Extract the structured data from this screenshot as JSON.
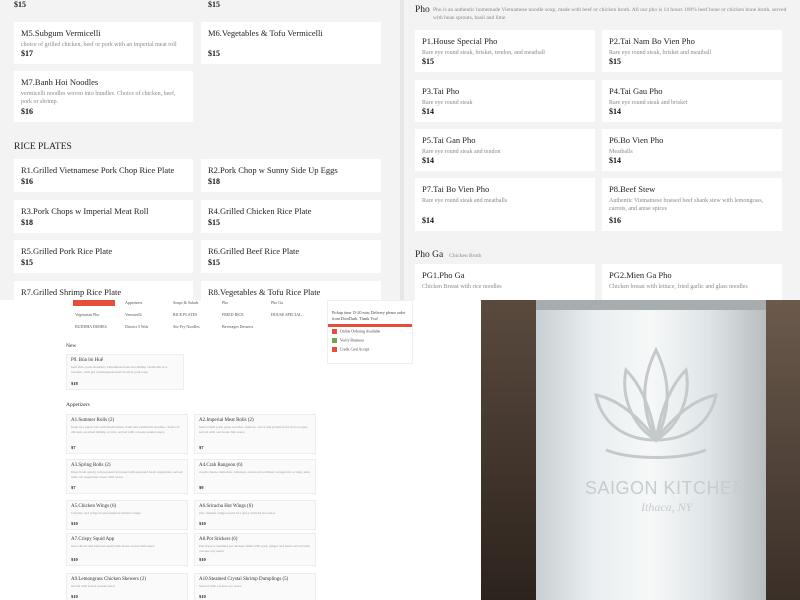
{
  "top_left": {
    "prices_top": [
      "$15",
      "$15"
    ],
    "items_top": [
      {
        "name": "M5.Subgum Vermicelli",
        "desc": "choice of grilled chicken, beef or pork with an imperial meat roll",
        "price": "$17"
      },
      {
        "name": "M6.Vegetables & Tofu Vermicelli",
        "desc": "",
        "price": "$15"
      },
      {
        "name": "M7.Banh Hoi Noodles",
        "desc": "vermicelli noodles woven into bundles. Choice of chicken, beef, pork or shrimp.",
        "price": "$16"
      }
    ],
    "section_title": "RICE PLATES",
    "rice_plates": [
      {
        "name": "R1.Grilled Vietnamese Pork Chop Rice Plate",
        "price": "$16"
      },
      {
        "name": "R2.Pork Chop w Sunny Side Up Eggs",
        "price": "$18"
      },
      {
        "name": "R3.Pork Chops w Imperial Meat Roll",
        "price": "$18"
      },
      {
        "name": "R4.Grilled Chicken Rice Plate",
        "price": "$15"
      },
      {
        "name": "R5.Grilled Pork Rice Plate",
        "price": "$15"
      },
      {
        "name": "R6.Grilled Beef Rice Plate",
        "price": "$15"
      },
      {
        "name": "R7.Grilled Shrimp Rice Plate",
        "price": ""
      },
      {
        "name": "R8.Vegetables & Tofu Rice Plate",
        "price": ""
      }
    ]
  },
  "top_right": {
    "section_title": "Pho",
    "section_desc": "Pho is an authentic homemade Vietnamese noodle soup, made with beef or chicken broth. All our pho is 14 hours 100% beef bone or chicken bone broth. served with bean sprouts, basil and lime",
    "items": [
      {
        "name": "P1.House Special Pho",
        "desc": "Rare eye round steak, brisket, tendon, and meatball",
        "price": "$15"
      },
      {
        "name": "P2.Tai Nam Bo Vien Pho",
        "desc": "Rare eye round steak, brisket and meatball",
        "price": "$15"
      },
      {
        "name": "P3.Tai Pho",
        "desc": "Rare eye round steak",
        "price": "$14"
      },
      {
        "name": "P4.Tai Gau Pho",
        "desc": "Rare eye round steak and brisket",
        "price": "$14"
      },
      {
        "name": "P5.Tai Gan Pho",
        "desc": "Rare eye round steak and tendon",
        "price": "$14"
      },
      {
        "name": "P6.Bo Vien Pho",
        "desc": "Meatballs",
        "price": "$14"
      },
      {
        "name": "P7.Tai Bo Vien Pho",
        "desc": "Rare eye round steak and meatballs",
        "price": "$14"
      },
      {
        "name": "P8.Beef Stew",
        "desc": "Authentic Vietnamese braised beef shank stew with lemongrass, carrots, and anise spices",
        "price": "$16"
      }
    ],
    "section2_title": "Pho Ga",
    "section2_sub": "Chicken Broth",
    "items2": [
      {
        "name": "PG1.Pho Ga",
        "desc": "Chicken Breast with rice noodles"
      },
      {
        "name": "PG2.Mien Ga Pho",
        "desc": "Chicken breast with lettuce, fried garlic and glass noodles"
      }
    ]
  },
  "bottom_left": {
    "nav": [
      [
        "",
        "Appetizers",
        "Soups & Salads",
        "Pho",
        "Pho Ga"
      ],
      [
        "Vegetarian Pho",
        "Vermicelli",
        "RICE PLATES",
        "FRIED RICE",
        "HOUSE SPECIAL..."
      ],
      [
        "BUDDHA DISHES",
        "District 5 Wok",
        "Stir Fry Noodles",
        "Beverages Desserts",
        ""
      ]
    ],
    "info_text": "Pickup time 15-20 min; Delivery please order from DoorDash, Thank You!",
    "badges": [
      "Online Ordering Available",
      "Verify Business",
      "Credit Card Accept"
    ],
    "new_title": "New",
    "new_item": {
      "name": "P9. Bún bò Huế",
      "desc": "beef shin, pork shoulder, Vietnamese ham and shrimp vermicelli rice noodles, with got a lemongrass beef broth in pork soup",
      "price": "$18"
    },
    "appetizers_title": "Appetizers",
    "appetizers": [
      {
        "name": "A1.Summer Rolls (2)",
        "desc": "fresh rice paper roll with fresh lettuce, basil and vermicelli noodles, choice of chicken, poached shrimp or tofu, served with a house peanut sauce",
        "price": "$7"
      },
      {
        "name": "A2.Imperial Meat Rolls (2)",
        "desc": "hand-rolled pork, glass noodles, shallots, carrot and jicama fried in rice paper, served with our house fish sauce",
        "price": "$7"
      },
      {
        "name": "A3.Spring Rolls (2)",
        "desc": "Deep fresh spring roll prepared in house with seasoned fresh vegetables, served with our vegetarian sweet chili sauce",
        "price": "$7"
      },
      {
        "name": "A4.Crab Rangoon (6)",
        "desc": "cream cheese, imitation crabmeat, onion and scallions wrapped in a crispy skin",
        "price": "$9"
      },
      {
        "name": "A5.Chicken Wings (6)",
        "desc": "Crunchy and crispy house battered chicken wings",
        "price": "$10"
      },
      {
        "name": "A6.Sriracha Hot Wings (6)",
        "desc": "Our chicken wings tossed in a spicy sriracha hot sauce",
        "price": "$10"
      },
      {
        "name": "A7.Crispy Squid App",
        "desc": "Juice sliced and battered squid with house sweet chili sauce",
        "price": "$10"
      },
      {
        "name": "A8.Pot Stickers (6)",
        "desc": "Pan fried or steamed pot stickers filled with pork, ginger and herbs served with a house soy sauce",
        "price": "$10"
      },
      {
        "name": "A9.Lemongrass Chicken Skewers (2)",
        "desc": "served with house peanut sauce",
        "price": "$10"
      },
      {
        "name": "A10.Steamed Crystal Shrimp Dumplings (5)",
        "desc": "Served with a house soy sauce",
        "price": "$10"
      }
    ]
  },
  "photo": {
    "logo_text": "SAIGON KITCHEN",
    "logo_subtext": "Ithaca, NY"
  },
  "colors": {
    "accent_red": "#e34f3b",
    "badge_green": "#6aa84f",
    "panel_bg": "#f3f3f3"
  }
}
